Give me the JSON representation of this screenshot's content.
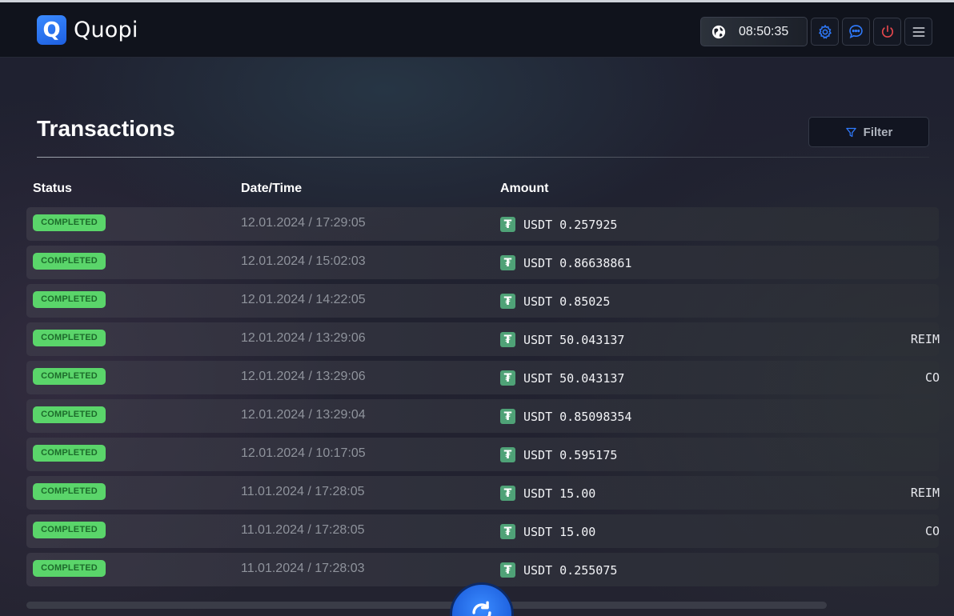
{
  "app": {
    "name": "Quopi",
    "logo_letter": "Q"
  },
  "header": {
    "clock": "08:50:35",
    "icons": [
      "globe-icon",
      "gear-icon",
      "chat-icon",
      "power-icon",
      "menu-icon"
    ]
  },
  "page": {
    "title": "Transactions",
    "filter_label": "Filter"
  },
  "table": {
    "columns": [
      "Status",
      "Date/Time",
      "Amount"
    ],
    "rows": [
      {
        "status": "COMPLETED",
        "datetime": "12.01.2024 / 17:29:05",
        "amount": "USDT 0.257925",
        "extra": ""
      },
      {
        "status": "COMPLETED",
        "datetime": "12.01.2024 / 15:02:03",
        "amount": "USDT 0.86638861",
        "extra": ""
      },
      {
        "status": "COMPLETED",
        "datetime": "12.01.2024 / 14:22:05",
        "amount": "USDT 0.85025",
        "extra": ""
      },
      {
        "status": "COMPLETED",
        "datetime": "12.01.2024 / 13:29:06",
        "amount": "USDT 50.043137",
        "extra": "REIM"
      },
      {
        "status": "COMPLETED",
        "datetime": "12.01.2024 / 13:29:06",
        "amount": "USDT 50.043137",
        "extra": "CO"
      },
      {
        "status": "COMPLETED",
        "datetime": "12.01.2024 / 13:29:04",
        "amount": "USDT 0.85098354",
        "extra": ""
      },
      {
        "status": "COMPLETED",
        "datetime": "12.01.2024 / 10:17:05",
        "amount": "USDT 0.595175",
        "extra": ""
      },
      {
        "status": "COMPLETED",
        "datetime": "11.01.2024 / 17:28:05",
        "amount": "USDT 15.00",
        "extra": "REIM"
      },
      {
        "status": "COMPLETED",
        "datetime": "11.01.2024 / 17:28:05",
        "amount": "USDT 15.00",
        "extra": "CO"
      },
      {
        "status": "COMPLETED",
        "datetime": "11.01.2024 / 17:28:03",
        "amount": "USDT 0.255075",
        "extra": ""
      }
    ]
  },
  "colors": {
    "accent": "#2f7bff",
    "status_completed": "#5ad56a",
    "tether": "#4fa277",
    "power": "#e5484d"
  }
}
